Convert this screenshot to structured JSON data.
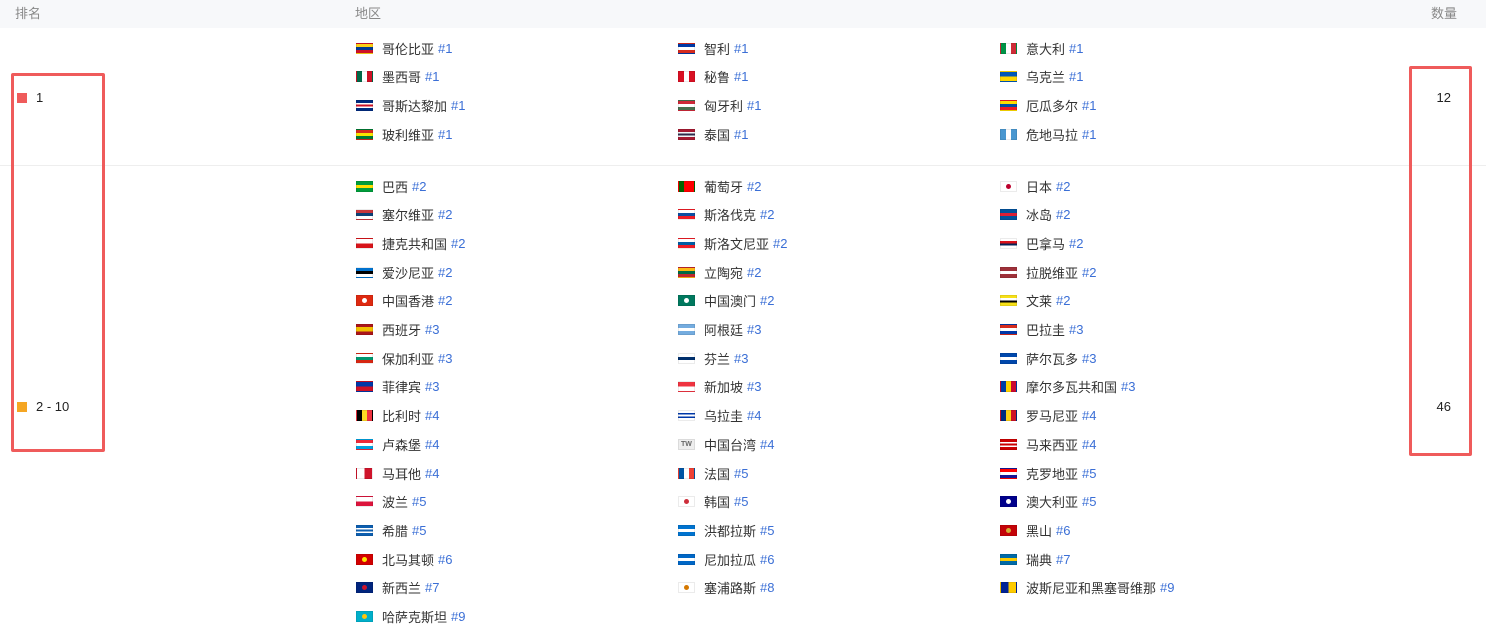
{
  "header": {
    "rank": "排名",
    "region": "地区",
    "count": "数量"
  },
  "groups": [
    {
      "rank": "1",
      "count": "12",
      "swatch_color": "#ef5b5b",
      "items": [
        {
          "name": "哥伦比亚",
          "rank": "#1",
          "flag": [
            "#fcd116",
            "#003893",
            "#ce1126"
          ],
          "dir": "h"
        },
        {
          "name": "智利",
          "rank": "#1",
          "flag": [
            "#0039a6",
            "#ffffff",
            "#d52b1e"
          ],
          "dir": "h"
        },
        {
          "name": "意大利",
          "rank": "#1",
          "flag": [
            "#009246",
            "#ffffff",
            "#ce2b37"
          ],
          "dir": "v"
        },
        {
          "name": "墨西哥",
          "rank": "#1",
          "flag": [
            "#006847",
            "#ffffff",
            "#ce1126"
          ],
          "dir": "v"
        },
        {
          "name": "秘鲁",
          "rank": "#1",
          "flag": [
            "#d91023",
            "#ffffff",
            "#d91023"
          ],
          "dir": "v"
        },
        {
          "name": "乌克兰",
          "rank": "#1",
          "flag": [
            "#0057b7",
            "#ffd700"
          ],
          "dir": "h"
        },
        {
          "name": "哥斯达黎加",
          "rank": "#1",
          "flag": [
            "#002b7f",
            "#ffffff",
            "#ce1126",
            "#ffffff",
            "#002b7f"
          ],
          "dir": "h"
        },
        {
          "name": "匈牙利",
          "rank": "#1",
          "flag": [
            "#ce2939",
            "#ffffff",
            "#477050"
          ],
          "dir": "h"
        },
        {
          "name": "厄瓜多尔",
          "rank": "#1",
          "flag": [
            "#ffdd00",
            "#034ea2",
            "#ed1c24"
          ],
          "dir": "h"
        },
        {
          "name": "玻利维亚",
          "rank": "#1",
          "flag": [
            "#d52b1e",
            "#f9e300",
            "#007934"
          ],
          "dir": "h"
        },
        {
          "name": "泰国",
          "rank": "#1",
          "flag": [
            "#a51931",
            "#f4f5f8",
            "#2d2a4a",
            "#f4f5f8",
            "#a51931"
          ],
          "dir": "h"
        },
        {
          "name": "危地马拉",
          "rank": "#1",
          "flag": [
            "#4997d0",
            "#ffffff",
            "#4997d0"
          ],
          "dir": "v"
        }
      ]
    },
    {
      "rank": "2 - 10",
      "count": "46",
      "swatch_color": "#f5a623",
      "items": [
        {
          "name": "巴西",
          "rank": "#2",
          "flag": [
            "#009c3b",
            "#ffdf00",
            "#009c3b"
          ],
          "dir": "h"
        },
        {
          "name": "葡萄牙",
          "rank": "#2",
          "flag": [
            "#006600",
            "#ff0000",
            "#ff0000"
          ],
          "dir": "v"
        },
        {
          "name": "日本",
          "rank": "#2",
          "flag": [
            "#ffffff",
            "#ffffff"
          ],
          "dir": "h",
          "dot": "#bc002d"
        },
        {
          "name": "塞尔维亚",
          "rank": "#2",
          "flag": [
            "#c6363c",
            "#0c4076",
            "#ffffff"
          ],
          "dir": "h"
        },
        {
          "name": "斯洛伐克",
          "rank": "#2",
          "flag": [
            "#ffffff",
            "#0b4ea2",
            "#ee1c25"
          ],
          "dir": "h"
        },
        {
          "name": "冰岛",
          "rank": "#2",
          "flag": [
            "#02529c",
            "#dc1e35",
            "#02529c"
          ],
          "dir": "h"
        },
        {
          "name": "捷克共和国",
          "rank": "#2",
          "flag": [
            "#ffffff",
            "#d7141a"
          ],
          "dir": "h"
        },
        {
          "name": "斯洛文尼亚",
          "rank": "#2",
          "flag": [
            "#ffffff",
            "#005da4",
            "#ed1c24"
          ],
          "dir": "h"
        },
        {
          "name": "巴拿马",
          "rank": "#2",
          "flag": [
            "#ffffff",
            "#da121a",
            "#072357",
            "#ffffff"
          ],
          "dir": "h"
        },
        {
          "name": "爱沙尼亚",
          "rank": "#2",
          "flag": [
            "#0072ce",
            "#000000",
            "#ffffff"
          ],
          "dir": "h"
        },
        {
          "name": "立陶宛",
          "rank": "#2",
          "flag": [
            "#fdb913",
            "#006a44",
            "#c1272d"
          ],
          "dir": "h"
        },
        {
          "name": "拉脱维亚",
          "rank": "#2",
          "flag": [
            "#9e3039",
            "#ffffff",
            "#9e3039"
          ],
          "dir": "h"
        },
        {
          "name": "中国香港",
          "rank": "#2",
          "flag": [
            "#de2910",
            "#de2910"
          ],
          "dir": "h",
          "dot": "#ffffff"
        },
        {
          "name": "中国澳门",
          "rank": "#2",
          "flag": [
            "#00785e",
            "#00785e"
          ],
          "dir": "h",
          "dot": "#ffffff"
        },
        {
          "name": "文莱",
          "rank": "#2",
          "flag": [
            "#f7e017",
            "#ffffff",
            "#000000",
            "#f7e017"
          ],
          "dir": "h"
        },
        {
          "name": "西班牙",
          "rank": "#3",
          "flag": [
            "#aa151b",
            "#f1bf00",
            "#f1bf00",
            "#aa151b"
          ],
          "dir": "h"
        },
        {
          "name": "阿根廷",
          "rank": "#3",
          "flag": [
            "#74acdf",
            "#ffffff",
            "#74acdf"
          ],
          "dir": "h"
        },
        {
          "name": "巴拉圭",
          "rank": "#3",
          "flag": [
            "#d52b1e",
            "#ffffff",
            "#0038a8"
          ],
          "dir": "h"
        },
        {
          "name": "保加利亚",
          "rank": "#3",
          "flag": [
            "#ffffff",
            "#00966e",
            "#d62612"
          ],
          "dir": "h"
        },
        {
          "name": "芬兰",
          "rank": "#3",
          "flag": [
            "#ffffff",
            "#002f6c",
            "#ffffff"
          ],
          "dir": "h"
        },
        {
          "name": "萨尔瓦多",
          "rank": "#3",
          "flag": [
            "#0047ab",
            "#ffffff",
            "#0047ab"
          ],
          "dir": "h"
        },
        {
          "name": "菲律宾",
          "rank": "#3",
          "flag": [
            "#0038a8",
            "#ce1126"
          ],
          "dir": "h"
        },
        {
          "name": "新加坡",
          "rank": "#3",
          "flag": [
            "#ef3340",
            "#ffffff"
          ],
          "dir": "h"
        },
        {
          "name": "摩尔多瓦共和国",
          "rank": "#3",
          "flag": [
            "#003da5",
            "#ffd200",
            "#cc092f"
          ],
          "dir": "v"
        },
        {
          "name": "比利时",
          "rank": "#4",
          "flag": [
            "#000000",
            "#fdda24",
            "#ef3340"
          ],
          "dir": "v"
        },
        {
          "name": "乌拉圭",
          "rank": "#4",
          "flag": [
            "#ffffff",
            "#0038a8",
            "#ffffff",
            "#0038a8",
            "#ffffff"
          ],
          "dir": "h"
        },
        {
          "name": "罗马尼亚",
          "rank": "#4",
          "flag": [
            "#002b7f",
            "#fcd116",
            "#ce1126"
          ],
          "dir": "v"
        },
        {
          "name": "卢森堡",
          "rank": "#4",
          "flag": [
            "#ed2939",
            "#ffffff",
            "#00a1de"
          ],
          "dir": "h"
        },
        {
          "name": "中国台湾",
          "rank": "#4",
          "flag": [
            "#eeeeee",
            "#eeeeee"
          ],
          "dir": "h",
          "text": "TW"
        },
        {
          "name": "马来西亚",
          "rank": "#4",
          "flag": [
            "#cc0001",
            "#ffffff",
            "#cc0001",
            "#ffffff",
            "#cc0001"
          ],
          "dir": "h"
        },
        {
          "name": "马耳他",
          "rank": "#4",
          "flag": [
            "#ffffff",
            "#cf142b"
          ],
          "dir": "v"
        },
        {
          "name": "法国",
          "rank": "#5",
          "flag": [
            "#0055a4",
            "#ffffff",
            "#ef4135"
          ],
          "dir": "v"
        },
        {
          "name": "克罗地亚",
          "rank": "#5",
          "flag": [
            "#ff0000",
            "#ffffff",
            "#171796"
          ],
          "dir": "h"
        },
        {
          "name": "波兰",
          "rank": "#5",
          "flag": [
            "#ffffff",
            "#dc143c"
          ],
          "dir": "h"
        },
        {
          "name": "韩国",
          "rank": "#5",
          "flag": [
            "#ffffff",
            "#ffffff"
          ],
          "dir": "h",
          "dot": "#cd2e3a"
        },
        {
          "name": "澳大利亚",
          "rank": "#5",
          "flag": [
            "#00008b",
            "#00008b"
          ],
          "dir": "h",
          "dot": "#ffffff"
        },
        {
          "name": "希腊",
          "rank": "#5",
          "flag": [
            "#0d5eaf",
            "#ffffff",
            "#0d5eaf",
            "#ffffff",
            "#0d5eaf"
          ],
          "dir": "h"
        },
        {
          "name": "洪都拉斯",
          "rank": "#5",
          "flag": [
            "#0073cf",
            "#ffffff",
            "#0073cf"
          ],
          "dir": "h"
        },
        {
          "name": "黑山",
          "rank": "#6",
          "flag": [
            "#c40308",
            "#c40308"
          ],
          "dir": "h",
          "dot": "#d4af37"
        },
        {
          "name": "北马其顿",
          "rank": "#6",
          "flag": [
            "#d20000",
            "#d20000"
          ],
          "dir": "h",
          "dot": "#ffe600"
        },
        {
          "name": "尼加拉瓜",
          "rank": "#6",
          "flag": [
            "#0067c6",
            "#ffffff",
            "#0067c6"
          ],
          "dir": "h"
        },
        {
          "name": "瑞典",
          "rank": "#7",
          "flag": [
            "#006aa7",
            "#fecc02",
            "#006aa7"
          ],
          "dir": "h"
        },
        {
          "name": "新西兰",
          "rank": "#7",
          "flag": [
            "#00247d",
            "#00247d"
          ],
          "dir": "h",
          "dot": "#cc142b"
        },
        {
          "name": "塞浦路斯",
          "rank": "#8",
          "flag": [
            "#ffffff",
            "#ffffff"
          ],
          "dir": "h",
          "dot": "#d57800"
        },
        {
          "name": "波斯尼亚和黑塞哥维那",
          "rank": "#9",
          "flag": [
            "#002395",
            "#fecb00"
          ],
          "dir": "v"
        },
        {
          "name": "哈萨克斯坦",
          "rank": "#9",
          "flag": [
            "#00afca",
            "#00afca"
          ],
          "dir": "h",
          "dot": "#fec50c"
        }
      ]
    }
  ]
}
